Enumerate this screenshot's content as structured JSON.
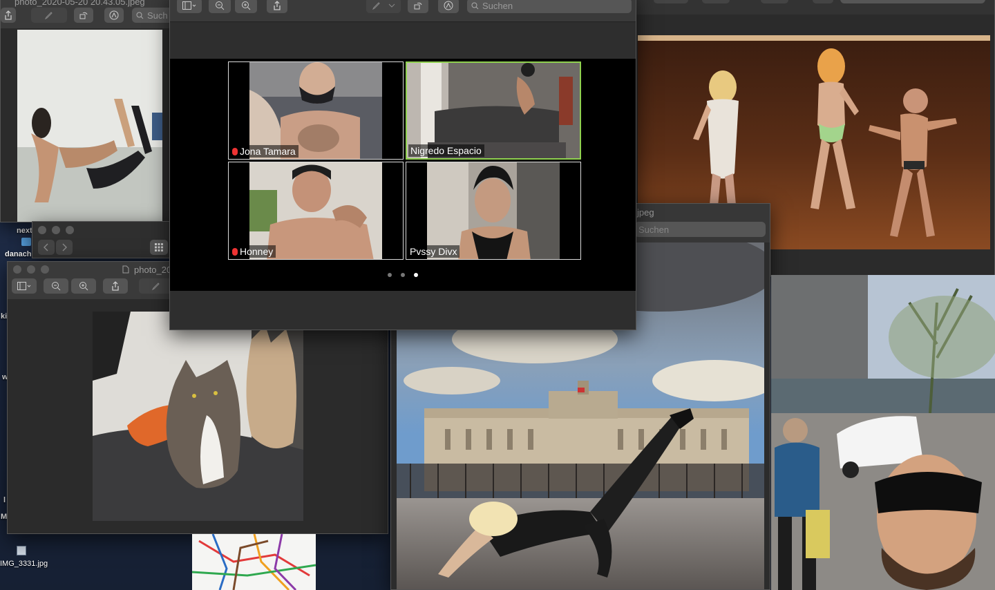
{
  "desktop": {
    "labels": [
      "next",
      "danach",
      "ki",
      "w",
      "l",
      "M"
    ],
    "file_icon_name": "IMG_3331.jpg"
  },
  "win_top_left": {
    "title": "photo_2020-05-20 20.43.05.jpeg",
    "search_placeholder": "Such"
  },
  "win_mini": {},
  "win_cats": {
    "title": "photo_20"
  },
  "zoom_window": {
    "search_placeholder": "Suchen",
    "participants": [
      {
        "name": "Jona Tamara",
        "muted": true,
        "active_speaker": false
      },
      {
        "name": "Nigredo Espacio",
        "muted": false,
        "active_speaker": true
      },
      {
        "name": "Honney",
        "muted": true,
        "active_speaker": false
      },
      {
        "name": "Pvssy Divx",
        "muted": false,
        "active_speaker": false
      }
    ],
    "page_dots": 3,
    "current_page": 3
  },
  "win_palace": {
    "title": "jpeg",
    "search_placeholder": "Suchen"
  },
  "colors": {
    "desktop": "#1b2740",
    "window_bg": "#2b2b2b",
    "titlebar": "#3a3a3a",
    "active_speaker_border": "#8fd14f",
    "stage_floor": "#7a3e1d"
  }
}
